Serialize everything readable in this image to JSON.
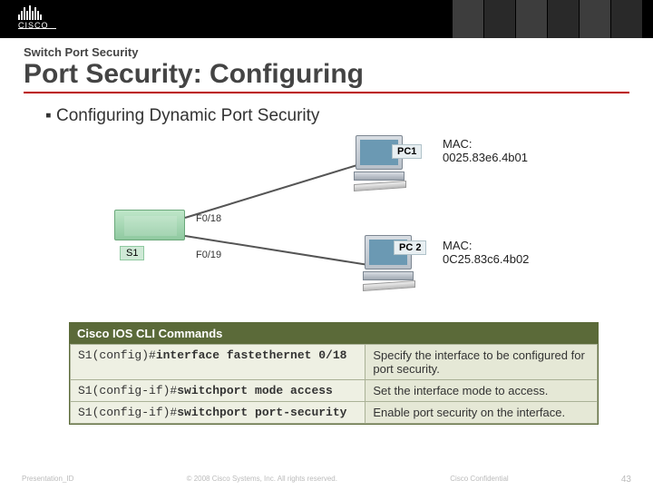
{
  "brand": "CISCO",
  "header": {
    "kicker": "Switch Port Security",
    "title": "Port Security: Configuring"
  },
  "bullet": "Configuring Dynamic Port Security",
  "diagram": {
    "switch_label": "S1",
    "port1": "F0/18",
    "port2": "F0/19",
    "pc1_label": "PC1",
    "pc2_label": "PC 2",
    "mac1_title": "MAC:",
    "mac1_value": "0025.83e6.4b01",
    "mac2_title": "MAC:",
    "mac2_value": "0C25.83c6.4b02"
  },
  "commands": {
    "heading": "Cisco IOS CLI Commands",
    "rows": [
      {
        "prompt": "S1(config)#",
        "cmd": "interface fastethernet 0/18",
        "desc": "Specify the interface to be configured for port security."
      },
      {
        "prompt": "S1(config-if)#",
        "cmd": "switchport mode access",
        "desc": "Set the interface mode to access."
      },
      {
        "prompt": "S1(config-if)#",
        "cmd": "switchport port-security",
        "desc": "Enable port security on the interface."
      }
    ]
  },
  "footer": {
    "left": "Presentation_ID",
    "center": "© 2008 Cisco Systems, Inc. All rights reserved.",
    "right": "Cisco Confidential",
    "page": "43"
  }
}
